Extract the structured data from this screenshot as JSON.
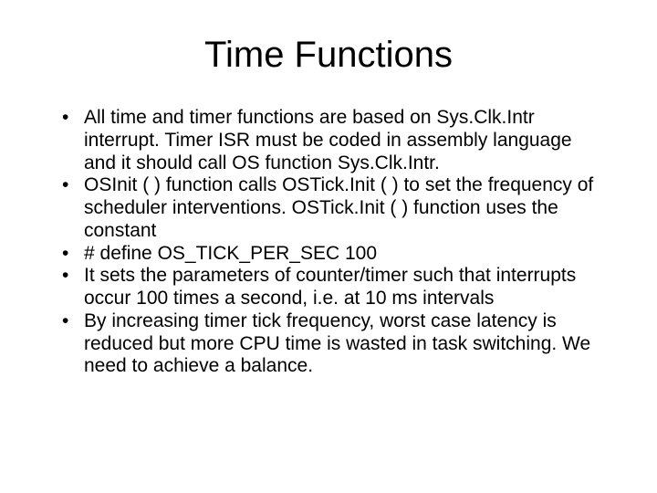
{
  "title": "Time Functions",
  "bullets": [
    "All time and timer functions are based on Sys.Clk.Intr interrupt. Timer ISR must be coded in assembly language and it should call OS function Sys.Clk.Intr.",
    "OSInit ( ) function calls OSTick.Init ( ) to set the frequency of scheduler interventions. OSTick.Init ( ) function uses the constant",
    "# define OS_TICK_PER_SEC 100",
    "It sets the parameters of counter/timer such that interrupts occur 100 times a second, i.e. at 10 ms intervals",
    "By increasing timer tick frequency, worst case latency is reduced but more CPU time is wasted in task switching. We need to achieve a balance."
  ]
}
